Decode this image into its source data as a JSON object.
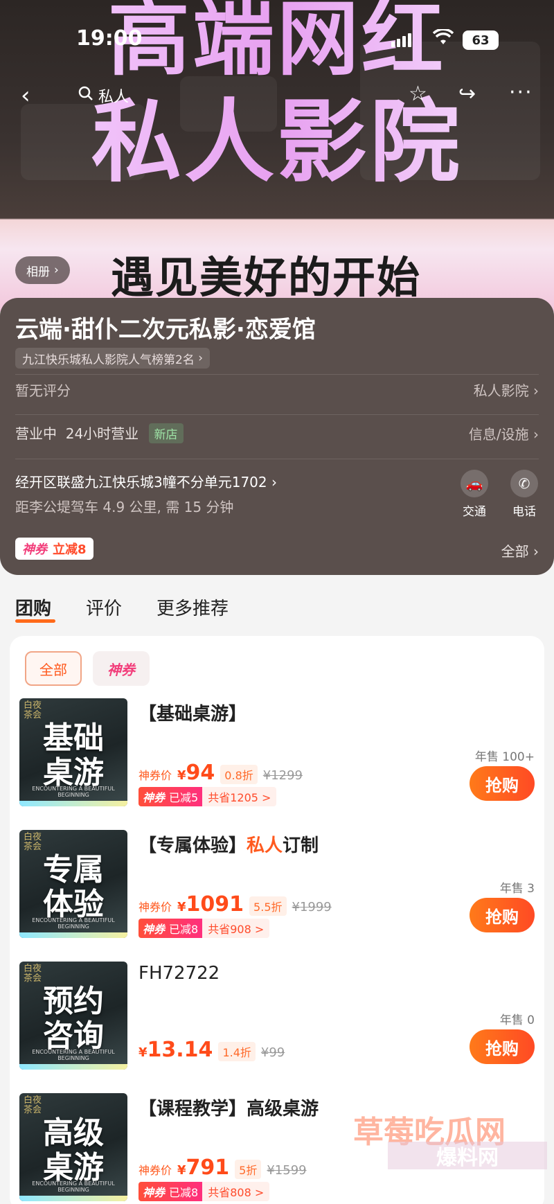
{
  "status": {
    "time": "19:00",
    "battery": "63"
  },
  "nav": {
    "search": "私人"
  },
  "hero": {
    "title_line1": "高端网红",
    "title_line2": "私人影院",
    "slogan": "遇见美好的开始",
    "album": "相册"
  },
  "shop": {
    "name": "云端·甜仆二次元私影·恋爱馆",
    "rank": "九江快乐城私人影院人气榜第2名",
    "rating": "暂无评分",
    "category": "私人影院",
    "status": "营业中",
    "hours": "24小时营业",
    "new_badge": "新店",
    "facility": "信息/设施",
    "address": "经开区联盛九江快乐城3幢不分单元1702",
    "distance": "距李公堤驾车 4.9 公里, 需 15 分钟",
    "action_traffic": "交通",
    "action_phone": "电话",
    "coupon_brand": "神券",
    "coupon_text": "立减8",
    "all_link": "全部"
  },
  "tabs": [
    "团购",
    "评价",
    "更多推荐"
  ],
  "filters": {
    "all": "全部",
    "shen": "神券"
  },
  "deals": [
    {
      "brand": "白夜茶会",
      "thumb1": "基础",
      "thumb2": "桌游",
      "title": "【基础桌游】",
      "title_hl": "",
      "title_tail": "",
      "price_label": "神券价",
      "price": "94",
      "discount": "0.8折",
      "orig": "¥1299",
      "tag_a": "神券",
      "tag_a2": "已减5",
      "tag_b": "共省1205 >",
      "sold": "年售 100+",
      "buy": "抢购"
    },
    {
      "brand": "白夜茶会",
      "thumb1": "专属",
      "thumb2": "体验",
      "title": "【专属体验】",
      "title_hl": "私人",
      "title_tail": "订制",
      "price_label": "神券价",
      "price": "1091",
      "discount": "5.5折",
      "orig": "¥1999",
      "tag_a": "神券",
      "tag_a2": "已减8",
      "tag_b": "共省908 >",
      "sold": "年售 3",
      "buy": "抢购"
    },
    {
      "brand": "白夜茶会",
      "thumb1": "预约",
      "thumb2": "咨询",
      "title": "FH72722",
      "title_hl": "",
      "title_tail": "",
      "price_label": "",
      "price": "13.14",
      "discount": "1.4折",
      "orig": "¥99",
      "tag_a": "",
      "tag_a2": "",
      "tag_b": "",
      "sold": "年售 0",
      "buy": "抢购"
    },
    {
      "brand": "白夜茶会",
      "thumb1": "高级",
      "thumb2": "桌游",
      "title": "【课程教学】高级桌游",
      "title_hl": "",
      "title_tail": "",
      "price_label": "神券价",
      "price": "791",
      "discount": "5折",
      "orig": "¥1599",
      "tag_a": "神券",
      "tag_a2": "已减8",
      "tag_b": "共省808 >",
      "sold": "",
      "buy": ""
    }
  ],
  "watermark": {
    "line1": "草莓吃瓜网",
    "line2": "爆料网"
  },
  "thumb_small": "ENCOUNTERING A BEAUTIFUL BEGINNING"
}
